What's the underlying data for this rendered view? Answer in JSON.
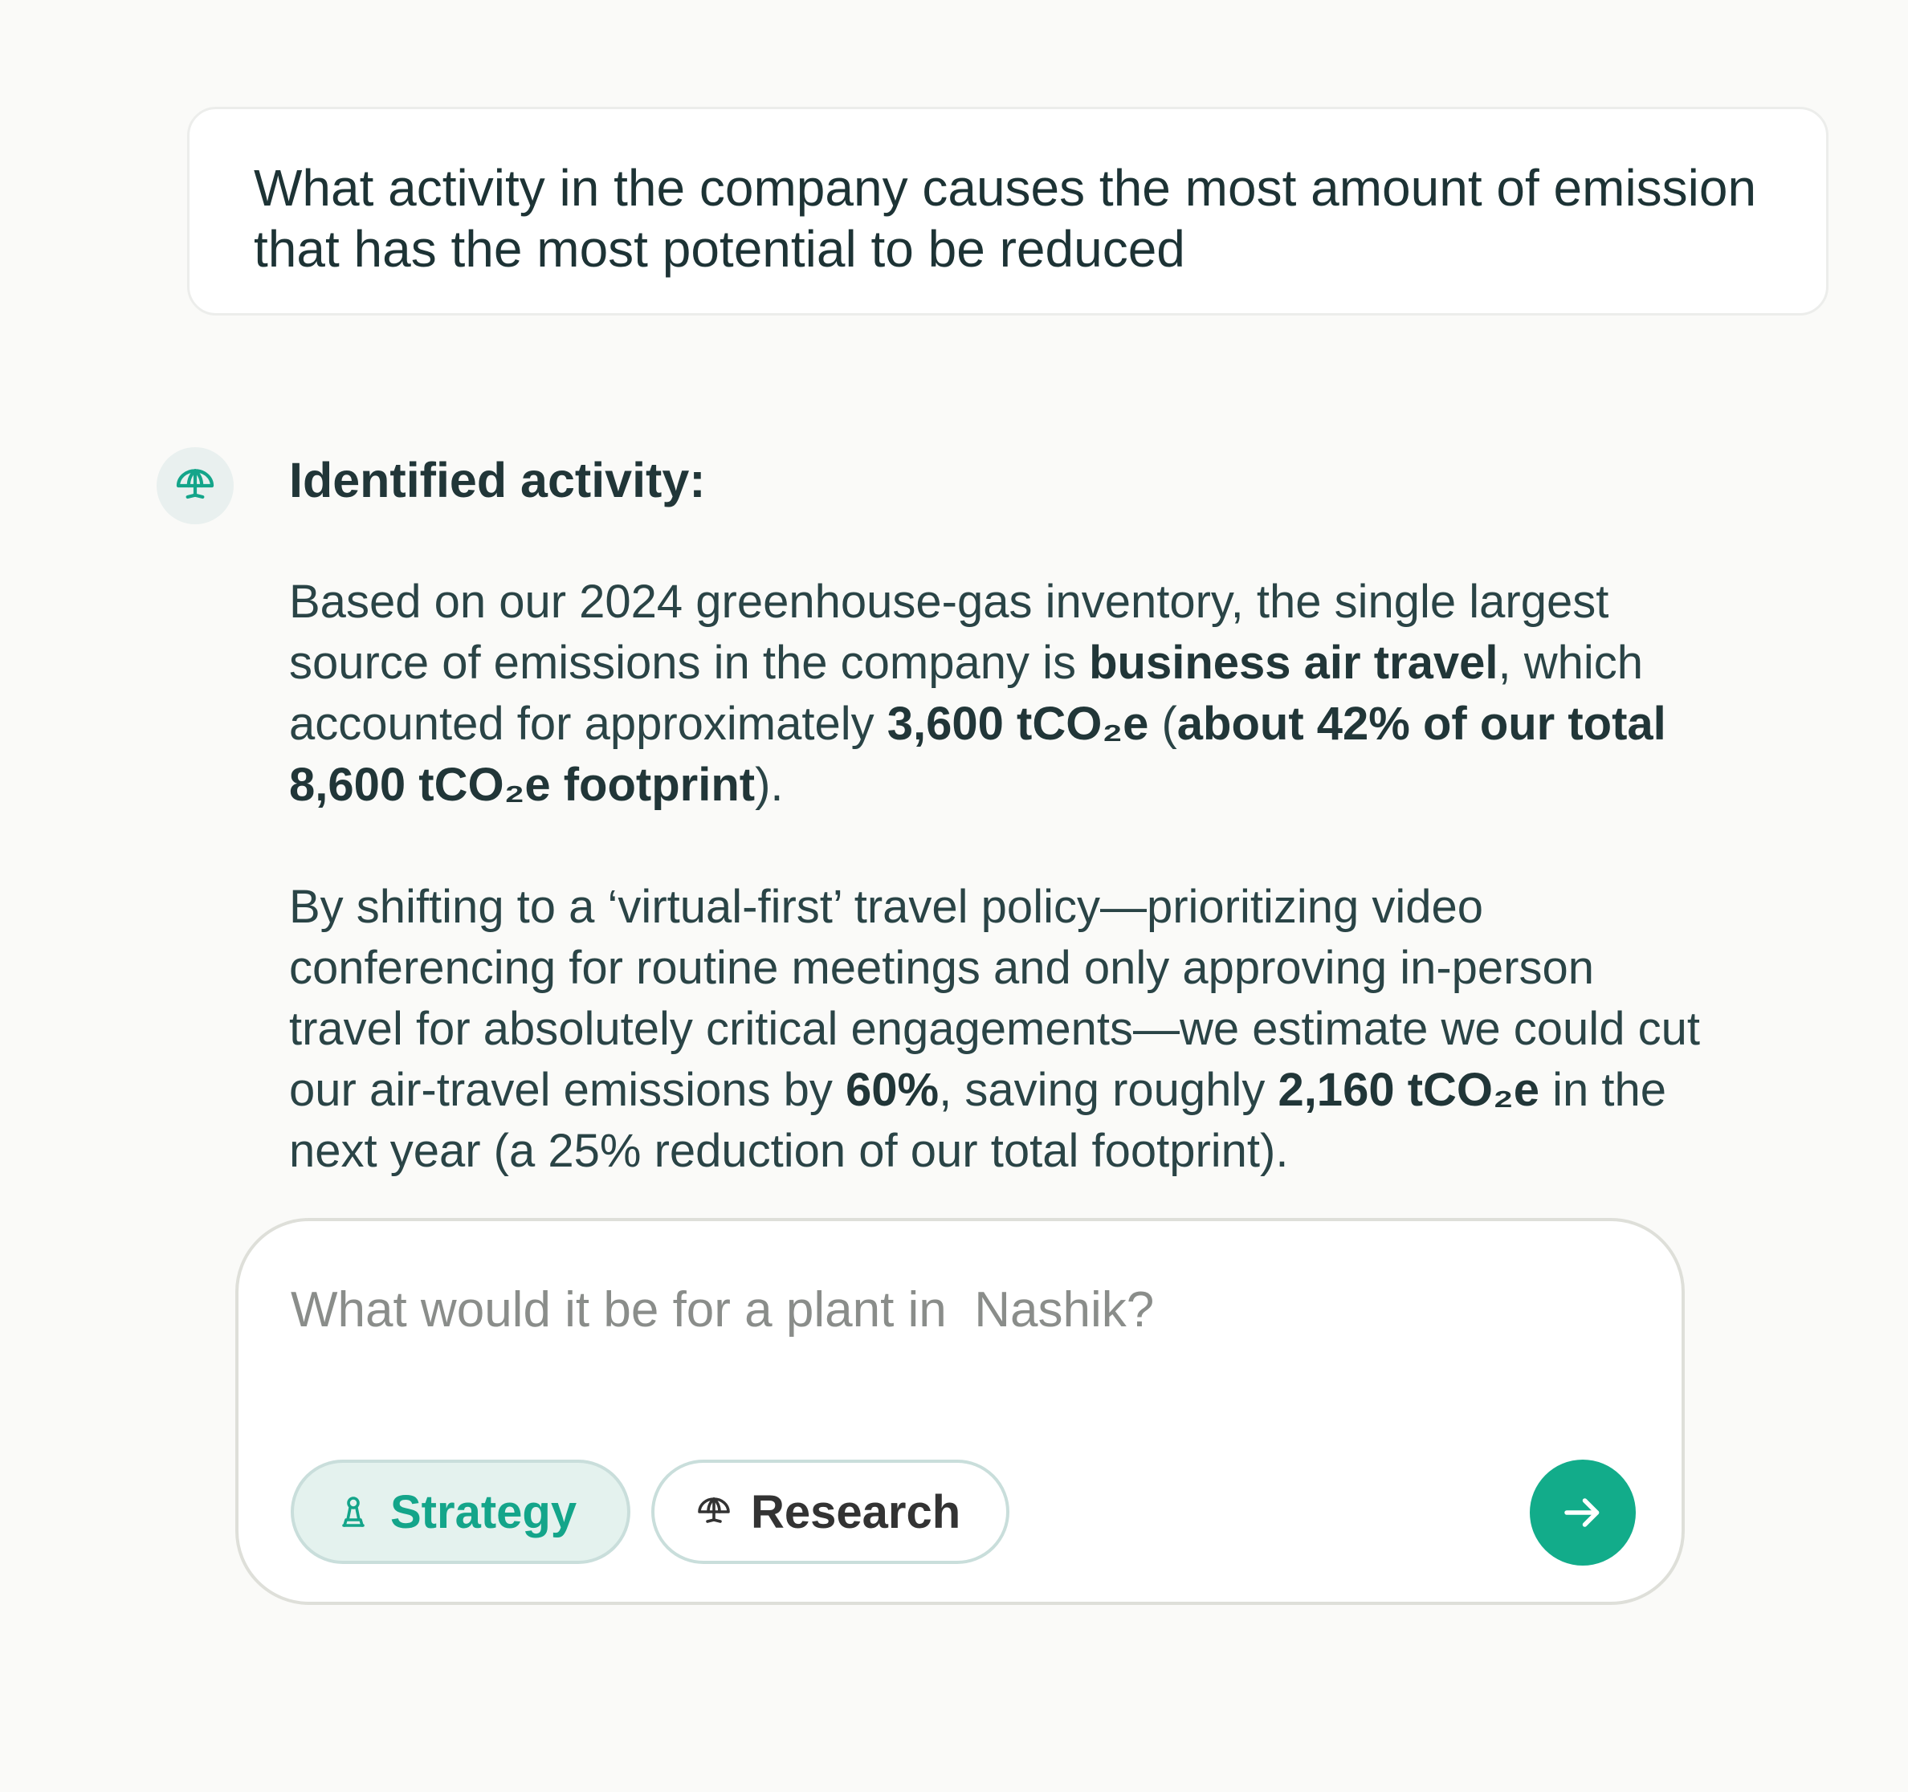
{
  "question": {
    "text": "What activity in the company causes the most amount of emission that has the most potential to be reduced"
  },
  "answer": {
    "avatar_icon": "umbrella-globe-icon",
    "heading": "Identified activity:",
    "para1": {
      "t1": "Based on our 2024 greenhouse-gas inventory, the single largest source of emissions in the company is ",
      "b1": "business air travel",
      "t2": ", which accounted for approximately ",
      "b2": "3,600 tCO₂e",
      "t3": " (",
      "b3": "about 42% of our total 8,600 tCO₂e footprint",
      "t4": ")."
    },
    "para2": {
      "t1": "By shifting to a ‘virtual-first’ travel policy—prioritizing video conferencing for routine meetings and only approving in-person travel for absolutely critical engagements—we estimate we could cut our air-travel emissions by ",
      "b1": "60%",
      "t2": ", saving roughly ",
      "b2": "2,160 tCO₂e",
      "t3": " in the next year (a 25% reduction of our total footprint)."
    }
  },
  "composer": {
    "placeholder": "What would it be for a plant in  Nashik?",
    "value": "",
    "chips": [
      {
        "label": "Strategy",
        "icon": "chess-pawn-icon",
        "active": true
      },
      {
        "label": "Research",
        "icon": "umbrella-globe-icon",
        "active": false
      }
    ],
    "send_icon": "arrow-right-icon"
  },
  "colors": {
    "background": "#fafaf8",
    "accent": "#12ac8a",
    "accent_soft": "#e4f2ee",
    "text_dark": "#213638",
    "placeholder": "#8a8d8a"
  }
}
